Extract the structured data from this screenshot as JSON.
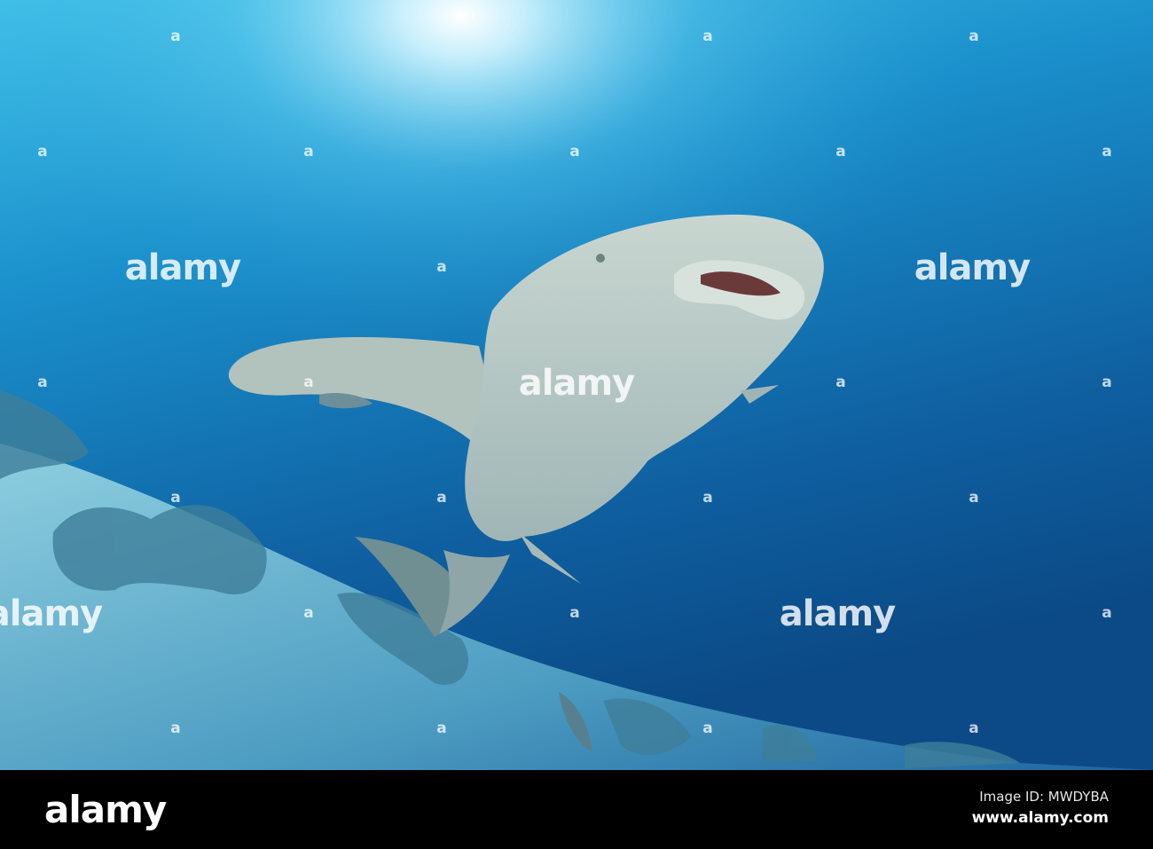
{
  "watermark": {
    "text": "alamy",
    "mini_mark": "a"
  },
  "footer": {
    "logo": "alamy",
    "image_id": "Image ID: MWDYBA",
    "url": "www.alamy.com"
  },
  "colors": {
    "water_top": "#5fd0ee",
    "water_mid": "#1b86c4",
    "water_deep": "#0d4f8c",
    "sand": "#7fc5d9",
    "shark": "#b9c9c4"
  }
}
